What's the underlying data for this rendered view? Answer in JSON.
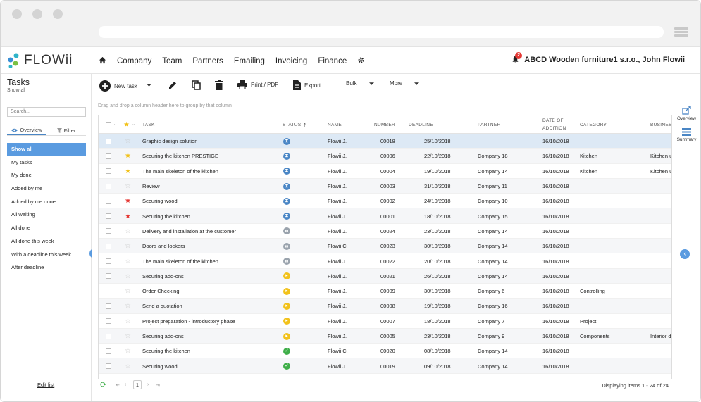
{
  "app": {
    "logo_text": "FLOWii",
    "brand_color": "#3a8fd6"
  },
  "nav": {
    "items": [
      "Company",
      "Team",
      "Partners",
      "Emailing",
      "Invoicing",
      "Finance"
    ],
    "notification_count": "2",
    "company": "ABCD Wooden furniture1 s.r.o., John Flowii"
  },
  "sidebar": {
    "title": "Tasks",
    "subtitle": "Show all",
    "search_placeholder": "Search...",
    "tabs": [
      {
        "label": "Overview",
        "icon": "eye-icon",
        "active": true
      },
      {
        "label": "Filter",
        "icon": "filter-icon",
        "active": false
      }
    ],
    "items": [
      {
        "label": "Show all",
        "active": true
      },
      {
        "label": "My tasks"
      },
      {
        "label": "My done"
      },
      {
        "label": "Added by me"
      },
      {
        "label": "Added by me done"
      },
      {
        "label": "All waiting"
      },
      {
        "label": "All done"
      },
      {
        "label": "All done this week"
      },
      {
        "label": "With a deadline this week"
      },
      {
        "label": "After deadline"
      }
    ],
    "edit_list": "Edit list"
  },
  "toolbar": {
    "new_task": "New task",
    "print": "Print / PDF",
    "export": "Export...",
    "bulk": "Bulk",
    "more": "More"
  },
  "grid": {
    "drag_hint": "Drag and drop a column header here to group by that column",
    "headers": {
      "task": "TASK",
      "status": "STATUS",
      "name": "NAME",
      "number": "NUMBER",
      "deadline": "DEADLINE",
      "partner": "PARTNER",
      "date_line1": "DATE OF",
      "date_line2": "ADDITION",
      "category": "CATEGORY",
      "business": "BUSINESS"
    },
    "status_colors": {
      "waiting": "#4a86c5",
      "paused": "#9aa3ad",
      "progress": "#f2c21b",
      "done": "#3fae49"
    },
    "rows": [
      {
        "task": "Graphic design solution",
        "star": "none",
        "status": "waiting",
        "name": "Flowii J.",
        "number": "00018",
        "deadline": "25/10/2018",
        "partner": "",
        "date": "16/10/2018",
        "category": "",
        "business": "",
        "selected": true
      },
      {
        "task": "Securing the kitchen PRESTIGE",
        "star": "gold",
        "status": "waiting",
        "name": "Flowii J.",
        "number": "00006",
        "deadline": "22/10/2018",
        "partner": "Company 18",
        "date": "16/10/2018",
        "category": "Kitchen",
        "business": "Kitchen u"
      },
      {
        "task": "The main skeleton of the kitchen",
        "star": "gold",
        "status": "waiting",
        "name": "Flowii J.",
        "number": "00004",
        "deadline": "19/10/2018",
        "partner": "Company 14",
        "date": "16/10/2018",
        "category": "Kitchen",
        "business": "Kitchen u"
      },
      {
        "task": "Review",
        "star": "none",
        "status": "waiting",
        "name": "Flowii J.",
        "number": "00003",
        "deadline": "31/10/2018",
        "partner": "Company 11",
        "date": "16/10/2018",
        "category": "",
        "business": ""
      },
      {
        "task": "Securing wood",
        "star": "red",
        "status": "waiting",
        "name": "Flowii J.",
        "number": "00002",
        "deadline": "24/10/2018",
        "partner": "Company 10",
        "date": "16/10/2018",
        "category": "",
        "business": ""
      },
      {
        "task": "Securing the kitchen",
        "star": "red",
        "status": "waiting",
        "name": "Flowii J.",
        "number": "00001",
        "deadline": "18/10/2018",
        "partner": "Company 15",
        "date": "16/10/2018",
        "category": "",
        "business": ""
      },
      {
        "task": "Delivery and installation at the customer",
        "star": "none",
        "status": "paused",
        "name": "Flowii J.",
        "number": "00024",
        "deadline": "23/10/2018",
        "partner": "Company 14",
        "date": "16/10/2018",
        "category": "",
        "business": ""
      },
      {
        "task": "Doors and lockers",
        "star": "none",
        "status": "paused",
        "name": "Flowii C.",
        "number": "00023",
        "deadline": "30/10/2018",
        "partner": "Company 14",
        "date": "16/10/2018",
        "category": "",
        "business": ""
      },
      {
        "task": "The main skeleton of the kitchen",
        "star": "none",
        "status": "paused",
        "name": "Flowii J.",
        "number": "00022",
        "deadline": "20/10/2018",
        "partner": "Company 14",
        "date": "16/10/2018",
        "category": "",
        "business": ""
      },
      {
        "task": "Securing add-ons",
        "star": "none",
        "status": "progress",
        "name": "Flowii J.",
        "number": "00021",
        "deadline": "26/10/2018",
        "partner": "Company 14",
        "date": "16/10/2018",
        "category": "",
        "business": ""
      },
      {
        "task": "Order Checking",
        "star": "none",
        "status": "progress",
        "name": "Flowii J.",
        "number": "00009",
        "deadline": "30/10/2018",
        "partner": "Company 6",
        "date": "16/10/2018",
        "category": "Controlling",
        "business": ""
      },
      {
        "task": "Send a quotation",
        "star": "none",
        "status": "progress",
        "name": "Flowii J.",
        "number": "00008",
        "deadline": "19/10/2018",
        "partner": "Company 16",
        "date": "16/10/2018",
        "category": "",
        "business": ""
      },
      {
        "task": "Project preparation - introductory phase",
        "star": "none",
        "status": "progress",
        "name": "Flowii J.",
        "number": "00007",
        "deadline": "18/10/2018",
        "partner": "Company 7",
        "date": "16/10/2018",
        "category": "Project",
        "business": ""
      },
      {
        "task": "Securing add-ons",
        "star": "none",
        "status": "progress",
        "name": "Flowii J.",
        "number": "00005",
        "deadline": "23/10/2018",
        "partner": "Company 9",
        "date": "16/10/2018",
        "category": "Components",
        "business": "Interior d"
      },
      {
        "task": "Securing the kitchen",
        "star": "none",
        "status": "done",
        "name": "Flowii C.",
        "number": "00020",
        "deadline": "08/10/2018",
        "partner": "Company 14",
        "date": "16/10/2018",
        "category": "",
        "business": ""
      },
      {
        "task": "Securing wood",
        "star": "none",
        "status": "done",
        "name": "Flowii J.",
        "number": "00019",
        "deadline": "09/10/2018",
        "partner": "Company 14",
        "date": "16/10/2018",
        "category": "",
        "business": ""
      }
    ]
  },
  "pagination": {
    "page": "1",
    "display": "Displaying items 1 - 24 of 24"
  },
  "right_panel": {
    "overview": "Overview",
    "summary": "Summary"
  }
}
